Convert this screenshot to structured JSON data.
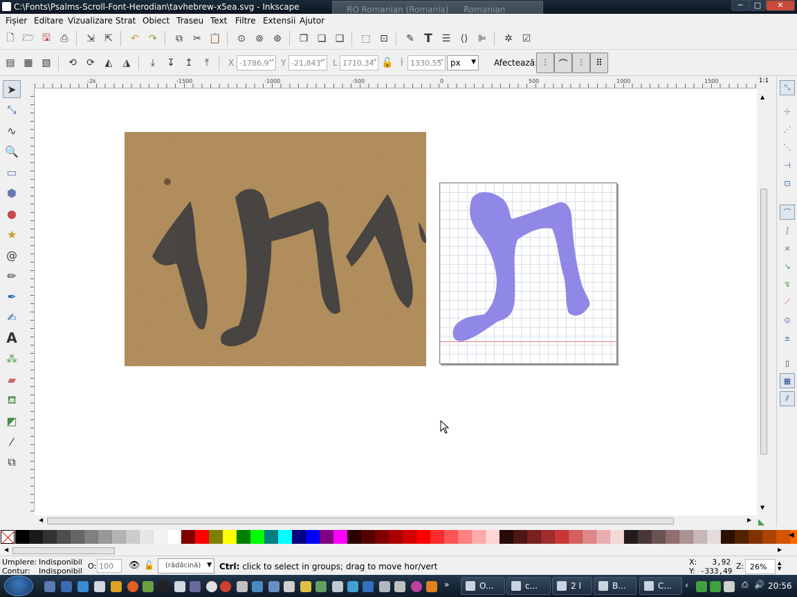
{
  "window": {
    "title": "C:\\Fonts\\Psalms-Scroll-Font-Herodian\\tavhebrew-x5ea.svg - Inkscape",
    "min": "─",
    "max": "□",
    "close": "✕"
  },
  "language_bar": {
    "layout": "RO Romanian (Romania)",
    "keyboard": "Romanian (Legacy)"
  },
  "menu": [
    "Fișier",
    "Editare",
    "Vizualizare",
    "Strat",
    "Obiect",
    "Traseu",
    "Text",
    "Filtre",
    "Extensii",
    "Ajutor"
  ],
  "controls": {
    "x_label": "X",
    "x_value": "-1786,9",
    "y_label": "Y",
    "y_value": "-21,843",
    "w_label": "L",
    "w_value": "1710,34",
    "h_label": "Î",
    "h_value": "1330,55",
    "unit": "px",
    "affect_label": "Afectează:"
  },
  "ruler": {
    "ticks": [
      "-2k",
      "-1500",
      "-1000",
      "-500",
      "0",
      "500",
      "1000",
      "1500"
    ]
  },
  "status": {
    "fill_label": "Umplere:",
    "fill_value": "Indisponibil",
    "stroke_label": "Contur:",
    "stroke_value": "Indisponibil",
    "opacity_label": "O:",
    "opacity_value": "100",
    "layer": "(rădăcină)",
    "message_key": "Ctrl:",
    "message": "click to select in groups; drag to move hor/vert",
    "x_label": "X:",
    "x_value": "3,92",
    "y_label": "Y:",
    "y_value": "-333,49",
    "zoom_label": "Z:",
    "zoom_value": "26%"
  },
  "palette": {
    "colors": [
      "#000000",
      "#1a1a1a",
      "#333333",
      "#4d4d4d",
      "#666666",
      "#808080",
      "#999999",
      "#b3b3b3",
      "#cccccc",
      "#e6e6e6",
      "#f2f2f2",
      "#ffffff",
      "#800000",
      "#ff0000",
      "#808000",
      "#ffff00",
      "#008000",
      "#00ff00",
      "#008080",
      "#00ffff",
      "#000080",
      "#0000ff",
      "#800080",
      "#ff00ff",
      "#2b0000",
      "#550000",
      "#800000",
      "#aa0000",
      "#d40000",
      "#ff0000",
      "#ff2a2a",
      "#ff5555",
      "#ff8080",
      "#ffaaaa",
      "#ffd5d5",
      "#280b0b",
      "#501616",
      "#782121",
      "#a02c2c",
      "#c83737",
      "#d35f5f",
      "#de8787",
      "#e9afaf",
      "#f4d7d7",
      "#241c1c",
      "#483737",
      "#6c5353",
      "#916f6f",
      "#ac9393",
      "#c8b7b7",
      "#e3dbdb",
      "#2b1100",
      "#552200",
      "#803300",
      "#aa4400",
      "#d45500",
      "#ff6600"
    ]
  },
  "glyph_fill": "#8f88e6",
  "taskbar": {
    "tasks": [
      "O...",
      "c...",
      "2 I",
      "B...",
      "C..."
    ],
    "clock": "20:56"
  }
}
